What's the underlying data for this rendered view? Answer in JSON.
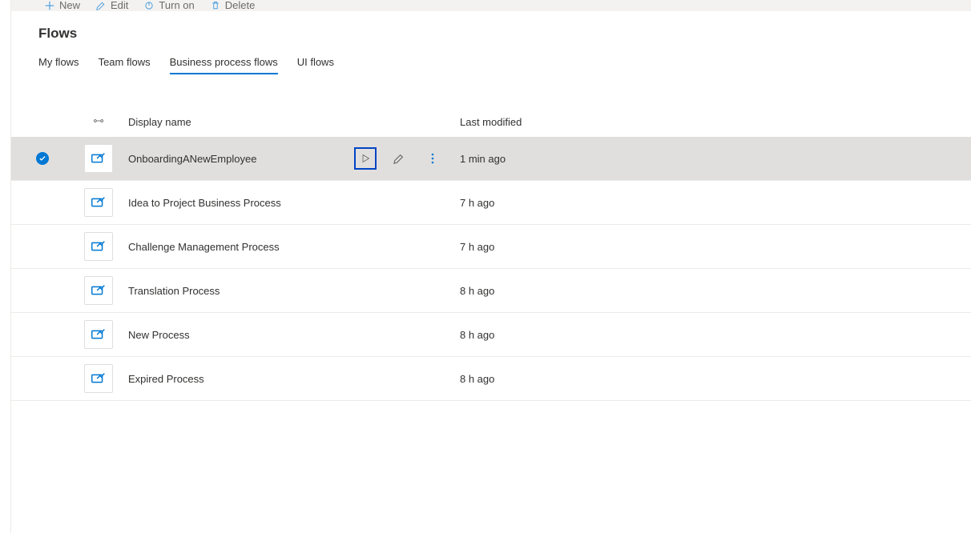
{
  "commandBar": {
    "new": "New",
    "edit": "Edit",
    "turnOn": "Turn on",
    "delete": "Delete"
  },
  "page": {
    "title": "Flows"
  },
  "tabs": [
    {
      "id": "my",
      "label": "My flows",
      "active": false
    },
    {
      "id": "team",
      "label": "Team flows",
      "active": false
    },
    {
      "id": "bpf",
      "label": "Business process flows",
      "active": true
    },
    {
      "id": "ui",
      "label": "UI flows",
      "active": false
    }
  ],
  "columns": {
    "displayName": "Display name",
    "lastModified": "Last modified"
  },
  "rows": [
    {
      "name": "OnboardingANewEmployee",
      "modified": "1 min ago",
      "selected": true
    },
    {
      "name": "Idea to Project Business Process",
      "modified": "7 h ago",
      "selected": false
    },
    {
      "name": "Challenge Management Process",
      "modified": "7 h ago",
      "selected": false
    },
    {
      "name": "Translation Process",
      "modified": "8 h ago",
      "selected": false
    },
    {
      "name": "New Process",
      "modified": "8 h ago",
      "selected": false
    },
    {
      "name": "Expired Process",
      "modified": "8 h ago",
      "selected": false
    }
  ]
}
